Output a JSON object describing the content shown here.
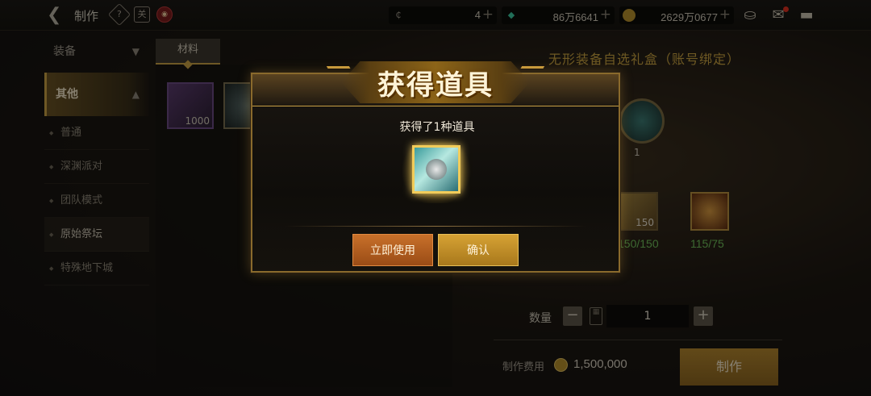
{
  "header": {
    "title": "制作",
    "icons": [
      "back-icon",
      "help-icon",
      "calendar-icon",
      "shop-icon"
    ],
    "calendar_glyph": "关",
    "currencies": [
      {
        "icon": "c-coin-icon",
        "glyph": "₵",
        "value": "4",
        "plus": "+"
      },
      {
        "icon": "gem-icon",
        "glyph": "◆",
        "value": "86万6641",
        "plus": "+"
      },
      {
        "icon": "gold-coin-icon",
        "glyph": "",
        "value": "2629万0677",
        "plus": "+"
      }
    ],
    "right_icons": [
      "bag-icon",
      "mail-icon",
      "chat-icon"
    ]
  },
  "sidebar": {
    "categories": [
      {
        "label": "装备",
        "expanded": false
      },
      {
        "label": "其他",
        "expanded": true
      }
    ],
    "sub_items": [
      {
        "label": "普通"
      },
      {
        "label": "深渊派对"
      },
      {
        "label": "团队模式"
      },
      {
        "label": "原始祭坛",
        "selected": true
      },
      {
        "label": "特殊地下城"
      }
    ]
  },
  "list": {
    "tab_label": "材料",
    "items": [
      {
        "qty": "1000"
      },
      {
        "qty": ""
      }
    ]
  },
  "detail": {
    "gift_title": "无形装备自选礼盒（账号绑定）",
    "result_qty": "1",
    "materials": [
      {
        "qty": "150",
        "count": "150/150"
      },
      {
        "qty": "",
        "count": "115/75"
      }
    ],
    "quantity_label": "数量",
    "quantity_value": "1",
    "minus": "−",
    "plus": "+",
    "cost_label": "制作费用",
    "cost_value": "1,500,000",
    "craft_button": "制作"
  },
  "modal": {
    "title": "获得道具",
    "message": "获得了1种道具",
    "use_button": "立即使用",
    "confirm_button": "确认"
  },
  "colors": {
    "accent_gold": "#c8a044",
    "count_ok_green": "#6fbf5a",
    "use_button_orange": "#c8702a",
    "confirm_button_gold": "#d6a234"
  }
}
